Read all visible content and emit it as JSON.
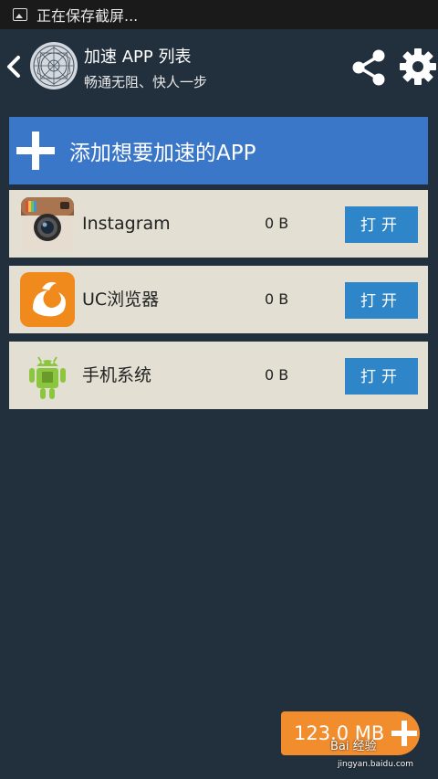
{
  "statusbar": {
    "text": "正在保存截屏..."
  },
  "header": {
    "title": "加速 APP 列表",
    "subtitle": "畅通无阻、快人一步"
  },
  "add_bar": {
    "label": "添加想要加速的APP"
  },
  "apps": [
    {
      "name": "Instagram",
      "size": "0 B",
      "button": "打开",
      "icon": "instagram-icon"
    },
    {
      "name": "UC浏览器",
      "size": "0 B",
      "button": "打开",
      "icon": "uc-browser-icon"
    },
    {
      "name": "手机系统",
      "size": "0 B",
      "button": "打开",
      "icon": "android-icon"
    }
  ],
  "float_button": {
    "label": "123.0 MB"
  },
  "watermark": {
    "text": "Bai 经验",
    "url": "jingyan.baidu.com"
  },
  "colors": {
    "background": "#22303d",
    "accent_blue": "#3b77c9",
    "button_blue": "#2e86c9",
    "row_bg": "#e3e0d3",
    "orange": "#f28d2e"
  }
}
